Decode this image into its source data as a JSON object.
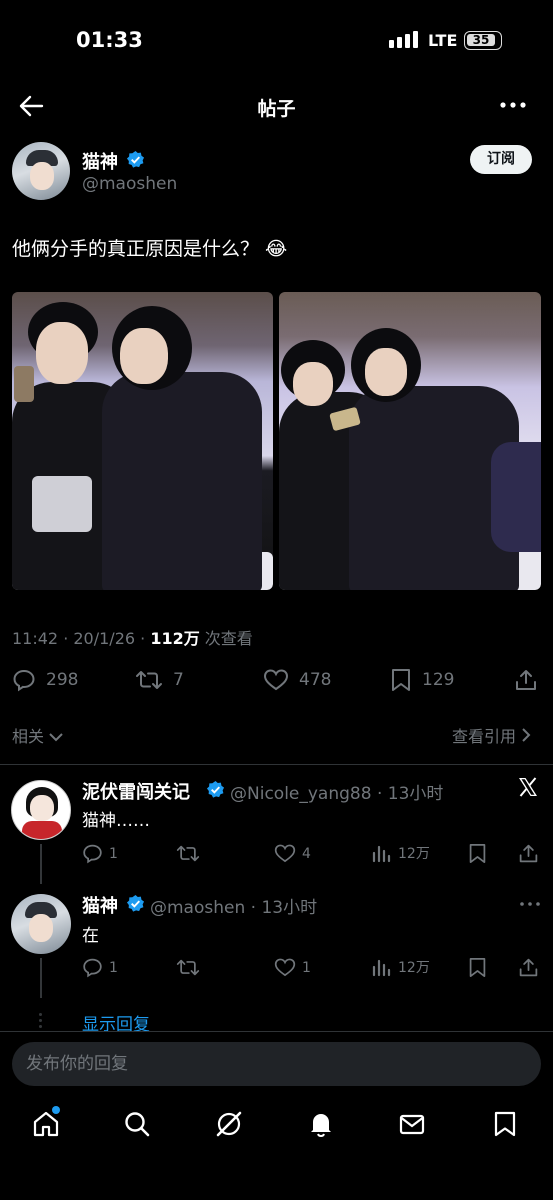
{
  "status_bar": {
    "time": "01:33",
    "network": "LTE",
    "battery": "35"
  },
  "header": {
    "title": "帖子"
  },
  "post": {
    "author_name": "猫神",
    "author_handle": "@maoshen",
    "subscribe_label": "订阅",
    "text": "他俩分手的真正原因是什么？ 😂",
    "time": "11:42 · 20/1/26 · ",
    "views_count": "112万",
    "views_label": " 次查看",
    "replies": "298",
    "reposts": "7",
    "likes": "478",
    "bookmarks": "129",
    "related_label": "相关",
    "view_quotes_label": "查看引用"
  },
  "replies": [
    {
      "name": "泥伏雷闯关记",
      "handle_time": "@Nicole_yang88 · 13小时",
      "text": "猫神……",
      "replies": "1",
      "likes": "4",
      "views": "12万"
    },
    {
      "name": "猫神",
      "handle_time": "@maoshen · 13小时",
      "text": "在",
      "replies": "1",
      "likes": "1",
      "views": "12万"
    }
  ],
  "show_replies_label": "显示回复",
  "compose": {
    "placeholder": "发布你的回复"
  },
  "colors": {
    "accent": "#1d9bf0",
    "background": "#000000",
    "secondary_text": "#71767b"
  }
}
